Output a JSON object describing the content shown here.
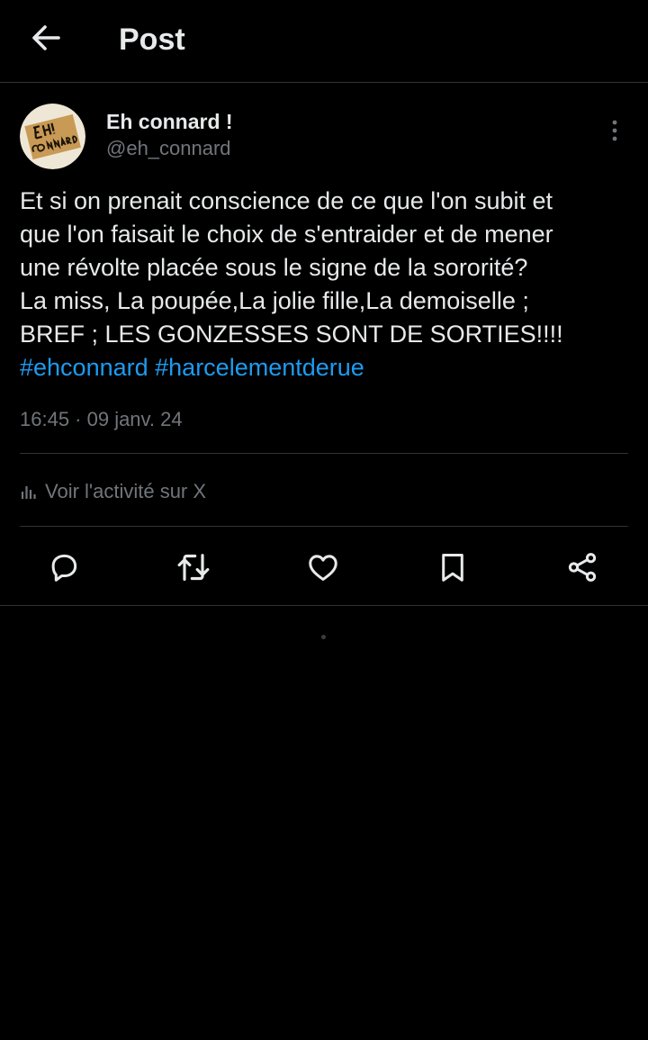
{
  "header": {
    "title": "Post",
    "back_icon": "arrow-left-icon"
  },
  "post": {
    "author": {
      "name": "Eh connard !",
      "handle": "@eh_connard",
      "avatar_text": "Eh! Connard"
    },
    "text_lines": [
      "Et si on prenait conscience de ce que l'on subit et",
      "que l'on faisait le choix de s'entraider et de mener",
      "une révolte placée sous le signe de la sororité?",
      "La miss, La poupée,La jolie fille,La demoiselle ;",
      "BREF ; LES GONZESSES SONT DE SORTIES!!!!"
    ],
    "hashtags": [
      "#ehconnard",
      "#harcelementderue"
    ],
    "timestamp": "16:45 · 09 janv. 24",
    "activity_label": "Voir l'activité sur X"
  },
  "actions": [
    {
      "name": "reply",
      "icon": "reply-icon"
    },
    {
      "name": "repost",
      "icon": "repost-icon"
    },
    {
      "name": "like",
      "icon": "heart-icon"
    },
    {
      "name": "bookmark",
      "icon": "bookmark-icon"
    },
    {
      "name": "share",
      "icon": "share-icon"
    }
  ],
  "colors": {
    "background": "#000000",
    "text": "#e7e9ea",
    "secondary_text": "#71767b",
    "hashtag": "#1d9bf0",
    "divider": "#2f3336"
  }
}
